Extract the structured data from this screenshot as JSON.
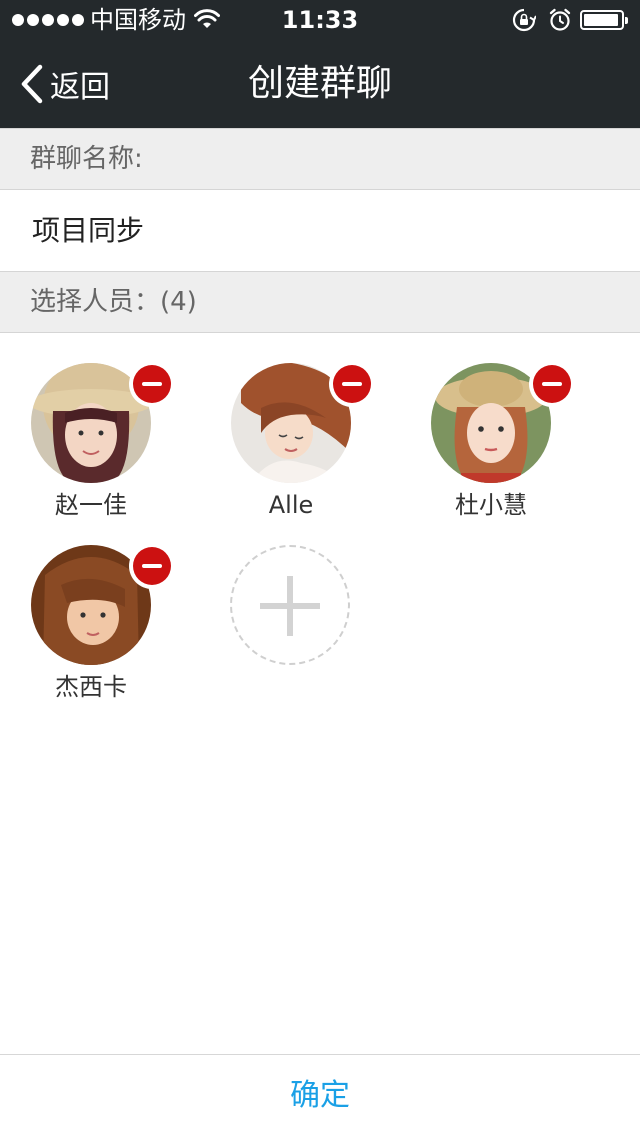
{
  "status_bar": {
    "carrier": "中国移动",
    "time": "11:33",
    "battery_level": 0.95
  },
  "nav": {
    "back_label": "返回",
    "title": "创建群聊"
  },
  "group_name": {
    "header": "群聊名称:",
    "value": "项目同步"
  },
  "members": {
    "header": "选择人员：(4)",
    "items": [
      {
        "name": "赵一佳"
      },
      {
        "name": "Alle"
      },
      {
        "name": "杜小慧"
      },
      {
        "name": "杰西卡"
      }
    ]
  },
  "footer": {
    "confirm_label": "确定"
  },
  "colors": {
    "nav_bg": "#24292c",
    "accent": "#1aa0e6",
    "remove_red": "#cc1111",
    "section_bg": "#eeeeee"
  },
  "icons": [
    "back-chevron-icon",
    "wifi-icon",
    "rotation-lock-icon",
    "alarm-icon",
    "battery-icon",
    "remove-icon",
    "plus-icon"
  ]
}
